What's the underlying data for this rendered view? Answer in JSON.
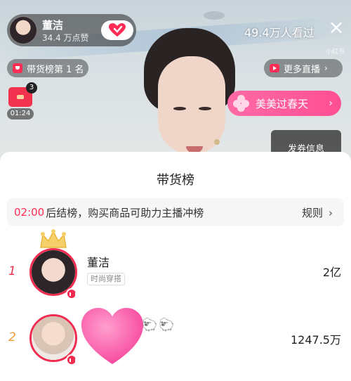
{
  "live": {
    "anchor_name": "董洁",
    "anchor_likes": "34.4 万点赞",
    "viewers": "49.4万人看过",
    "close_icon": "close-icon",
    "watermark": "小红书",
    "rank_badge": "带货榜第 1 名",
    "more_live": "更多直播",
    "redpacket_count": "3",
    "redpacket_timer": "01:24",
    "event_banner": "美美过春天",
    "coupon_button": "发券信息"
  },
  "leaderboard": {
    "title": "带货榜",
    "notice_time": "02:00",
    "notice_text": "后结榜，购买商品可助力主播冲榜",
    "rules_label": "规则",
    "rows": [
      {
        "rank": "1",
        "name": "董洁",
        "tag": "时尚穿搭",
        "sales": "2亿"
      },
      {
        "rank": "2",
        "name": "",
        "tag": "",
        "sales": "1247.5万"
      }
    ]
  },
  "colors": {
    "accent": "#ff2d55",
    "rank1": "#e8344e",
    "rank2": "#f29a34",
    "event_banner": "#ff4f93"
  }
}
